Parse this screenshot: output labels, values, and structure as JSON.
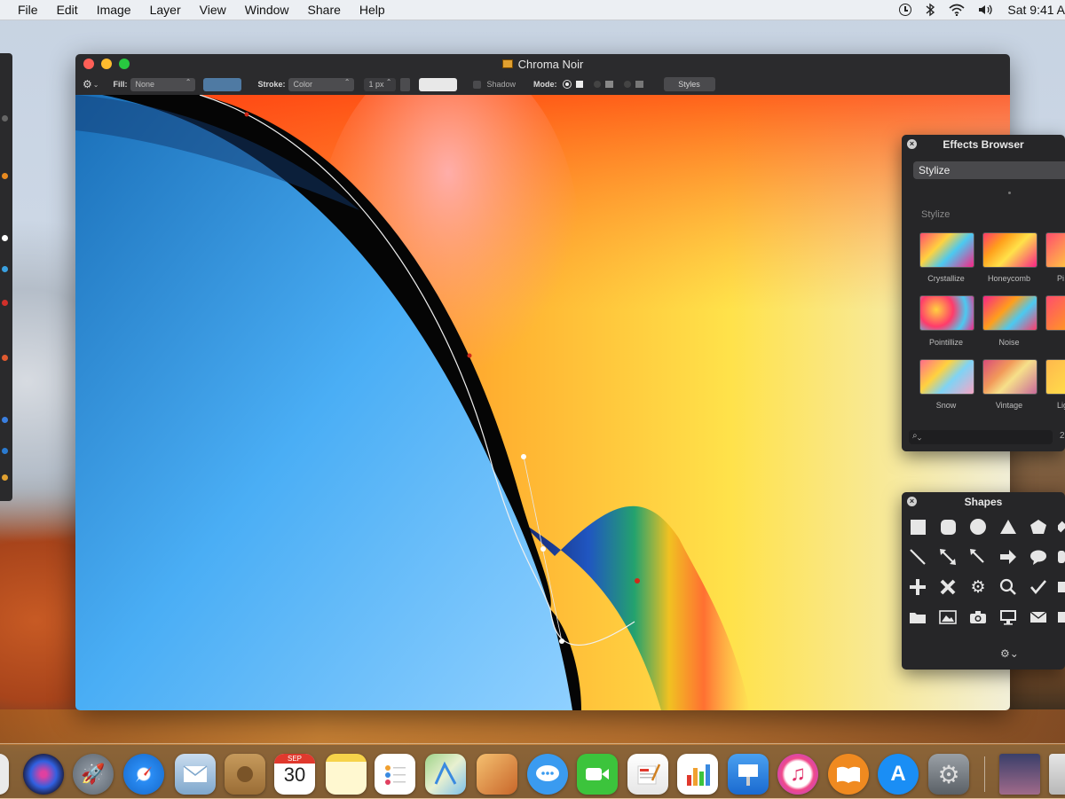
{
  "menubar": {
    "menus": [
      "File",
      "Edit",
      "Image",
      "Layer",
      "View",
      "Window",
      "Share",
      "Help"
    ],
    "datetime": "Sat 9:41 A"
  },
  "window": {
    "title": "Chroma Noir",
    "toolbar": {
      "fill_label": "Fill:",
      "fill_value": "None",
      "stroke_label": "Stroke:",
      "stroke_value": "Color",
      "stroke_width": "1 px",
      "shadow_label": "Shadow",
      "mode_label": "Mode:",
      "styles_button": "Styles"
    }
  },
  "effects_browser": {
    "title": "Effects Browser",
    "category": "Stylize",
    "section": "Stylize",
    "effects": [
      {
        "label": "Crystallize"
      },
      {
        "label": "Honeycomb"
      },
      {
        "label": "Pi"
      },
      {
        "label": "Pointillize"
      },
      {
        "label": "Noise"
      },
      {
        "label": ""
      },
      {
        "label": "Snow"
      },
      {
        "label": "Vintage"
      },
      {
        "label": "Lig"
      }
    ],
    "search_icon": "magnifier-icon",
    "count": "2"
  },
  "shapes_panel": {
    "title": "Shapes",
    "shapes": [
      "square",
      "rounded-square",
      "circle",
      "triangle",
      "pentagon",
      "line",
      "double-arrow",
      "arrow-diagonal",
      "arrow-right",
      "speech-bubble",
      "plus",
      "cross",
      "gear",
      "magnifier",
      "checkmark",
      "folder",
      "picture",
      "camera",
      "monitor",
      "envelope"
    ]
  },
  "dock": {
    "items": [
      "Finder",
      "Siri",
      "Launchpad",
      "Safari",
      "Mail",
      "Contacts",
      "Calendar",
      "Notes",
      "Reminders",
      "Maps",
      "Photos",
      "Messages",
      "FaceTime",
      "News",
      "Numbers",
      "Keynote",
      "iTunes",
      "iBooks",
      "App Store",
      "System Preferences",
      "Desktop Folder",
      "Trash"
    ],
    "calendar_month": "SEP",
    "calendar_day": "30"
  },
  "colors": {
    "window_bg": "#2b2b2d",
    "panel_bg": "#262628",
    "fill_swatch": "#4f7aa3",
    "stroke_swatch": "#e8e8e8",
    "close": "#ff5f57",
    "minimize": "#febc2e",
    "zoom": "#28c840"
  }
}
